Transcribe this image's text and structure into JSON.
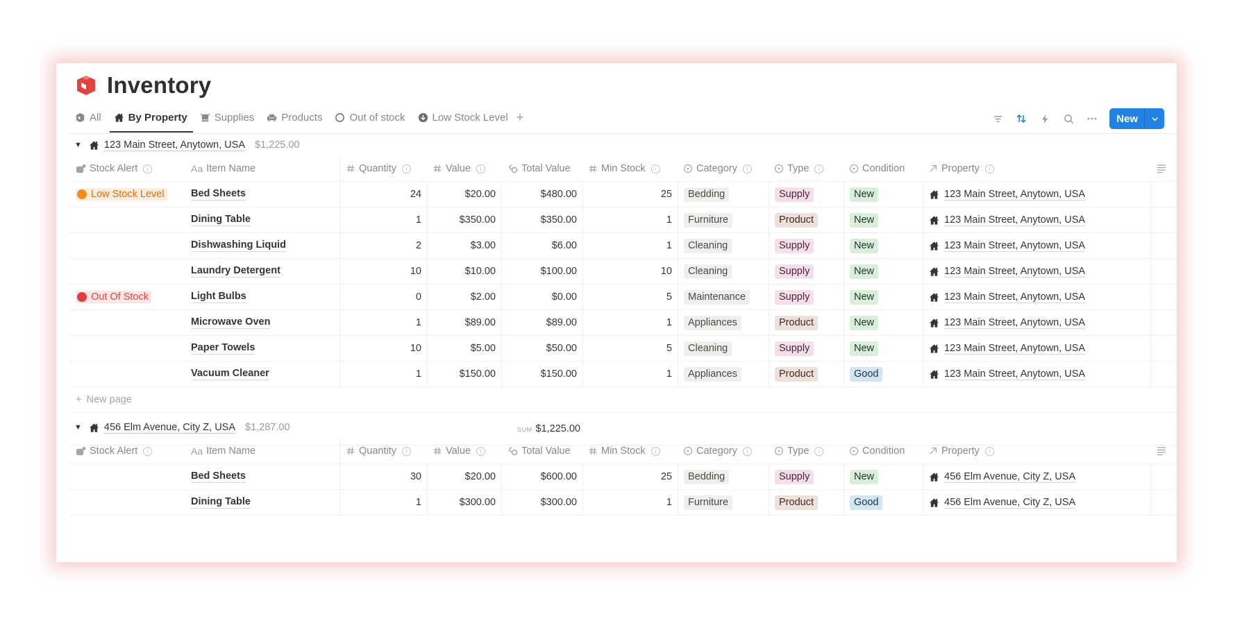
{
  "page": {
    "title": "Inventory",
    "title_icon": "box-icon"
  },
  "tabs": [
    {
      "label": "All",
      "icon": "box-icon",
      "active": false
    },
    {
      "label": "By Property",
      "icon": "home-icon",
      "active": true
    },
    {
      "label": "Supplies",
      "icon": "shelf-icon",
      "active": false
    },
    {
      "label": "Products",
      "icon": "sofa-icon",
      "active": false
    },
    {
      "label": "Out of stock",
      "icon": "circle-icon",
      "active": false
    },
    {
      "label": "Low Stock Level",
      "icon": "down-arrow-circle-icon",
      "active": false
    }
  ],
  "add_tab": "+",
  "toolbar": {
    "icons": [
      "filter-icon",
      "sort-icon",
      "automation-icon",
      "search-icon",
      "more-icon"
    ],
    "new_label": "New",
    "colors": {
      "accent": "#2383e2"
    }
  },
  "columns": {
    "stock_alert": "Stock Alert",
    "item_name": "Item Name",
    "quantity": "Quantity",
    "value": "Value",
    "total_value": "Total Value",
    "min_stock": "Min Stock",
    "category": "Category",
    "type": "Type",
    "condition": "Condition",
    "property": "Property",
    "name_prefix": "Aa",
    "hash": "#",
    "info": "i"
  },
  "new_page_label": "New page",
  "sum_label": "SUM",
  "groups": [
    {
      "name": "123 Main Street, Anytown, USA",
      "sum": "$1,225.00",
      "footer_sum": "$1,225.00",
      "rows": [
        {
          "alert": "Low Stock Level",
          "alert_color": "orange",
          "name": "Bed Sheets",
          "qty": "24",
          "value": "$20.00",
          "total": "$480.00",
          "min": "25",
          "category": "Bedding",
          "type": "Supply",
          "condition": "New",
          "property": "123 Main Street, Anytown, USA"
        },
        {
          "alert": "",
          "alert_color": "",
          "name": "Dining Table",
          "qty": "1",
          "value": "$350.00",
          "total": "$350.00",
          "min": "1",
          "category": "Furniture",
          "type": "Product",
          "condition": "New",
          "property": "123 Main Street, Anytown, USA"
        },
        {
          "alert": "",
          "alert_color": "",
          "name": "Dishwashing Liquid",
          "qty": "2",
          "value": "$3.00",
          "total": "$6.00",
          "min": "1",
          "category": "Cleaning",
          "type": "Supply",
          "condition": "New",
          "property": "123 Main Street, Anytown, USA"
        },
        {
          "alert": "",
          "alert_color": "",
          "name": "Laundry Detergent",
          "qty": "10",
          "value": "$10.00",
          "total": "$100.00",
          "min": "10",
          "category": "Cleaning",
          "type": "Supply",
          "condition": "New",
          "property": "123 Main Street, Anytown, USA"
        },
        {
          "alert": "Out Of Stock",
          "alert_color": "red",
          "name": "Light Bulbs",
          "qty": "0",
          "value": "$2.00",
          "total": "$0.00",
          "min": "5",
          "category": "Maintenance",
          "type": "Supply",
          "condition": "New",
          "property": "123 Main Street, Anytown, USA"
        },
        {
          "alert": "",
          "alert_color": "",
          "name": "Microwave Oven",
          "qty": "1",
          "value": "$89.00",
          "total": "$89.00",
          "min": "1",
          "category": "Appliances",
          "type": "Product",
          "condition": "New",
          "property": "123 Main Street, Anytown, USA"
        },
        {
          "alert": "",
          "alert_color": "",
          "name": "Paper Towels",
          "qty": "10",
          "value": "$5.00",
          "total": "$50.00",
          "min": "5",
          "category": "Cleaning",
          "type": "Supply",
          "condition": "New",
          "property": "123 Main Street, Anytown, USA"
        },
        {
          "alert": "",
          "alert_color": "",
          "name": "Vacuum Cleaner",
          "qty": "1",
          "value": "$150.00",
          "total": "$150.00",
          "min": "1",
          "category": "Appliances",
          "type": "Product",
          "condition": "Good",
          "property": "123 Main Street, Anytown, USA"
        }
      ]
    },
    {
      "name": "456 Elm Avenue, City Z, USA",
      "sum": "$1,287.00",
      "rows": [
        {
          "alert": "",
          "alert_color": "",
          "name": "Bed Sheets",
          "qty": "30",
          "value": "$20.00",
          "total": "$600.00",
          "min": "25",
          "category": "Bedding",
          "type": "Supply",
          "condition": "New",
          "property": "456 Elm Avenue, City Z, USA"
        },
        {
          "alert": "",
          "alert_color": "",
          "name": "Dining Table",
          "qty": "1",
          "value": "$300.00",
          "total": "$300.00",
          "min": "1",
          "category": "Furniture",
          "type": "Product",
          "condition": "Good",
          "property": "456 Elm Avenue, City Z, USA"
        }
      ]
    }
  ],
  "tag_colors": {
    "type": {
      "Supply": "pink",
      "Product": "brown"
    },
    "condition": {
      "New": "green",
      "Good": "blue"
    },
    "alert": {
      "orange": {
        "dot": "#f28c18",
        "text": "#d9730d",
        "bg": "#fbecdd"
      },
      "red": {
        "dot": "#e03e3e",
        "text": "#d44c47",
        "bg": "#fbe4e4"
      }
    }
  }
}
